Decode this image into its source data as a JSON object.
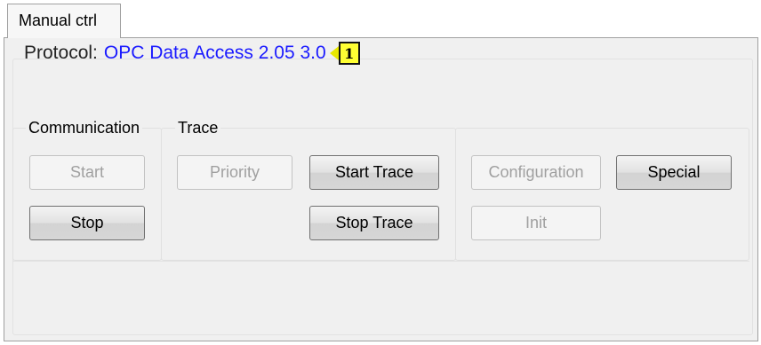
{
  "tab": {
    "label": "Manual ctrl"
  },
  "protocol": {
    "label": "Protocol:",
    "value": "OPC Data Access 2.05 3.0",
    "badge": "1"
  },
  "sections": {
    "communication": {
      "title": "Communication"
    },
    "trace": {
      "title": "Trace"
    }
  },
  "buttons": {
    "start": "Start",
    "stop": "Stop",
    "priority": "Priority",
    "start_trace": "Start Trace",
    "stop_trace": "Stop Trace",
    "configuration": "Configuration",
    "special": "Special",
    "init": "Init"
  },
  "colors": {
    "protocol_value": "#1a1aff",
    "badge_fill": "#ffff33"
  }
}
